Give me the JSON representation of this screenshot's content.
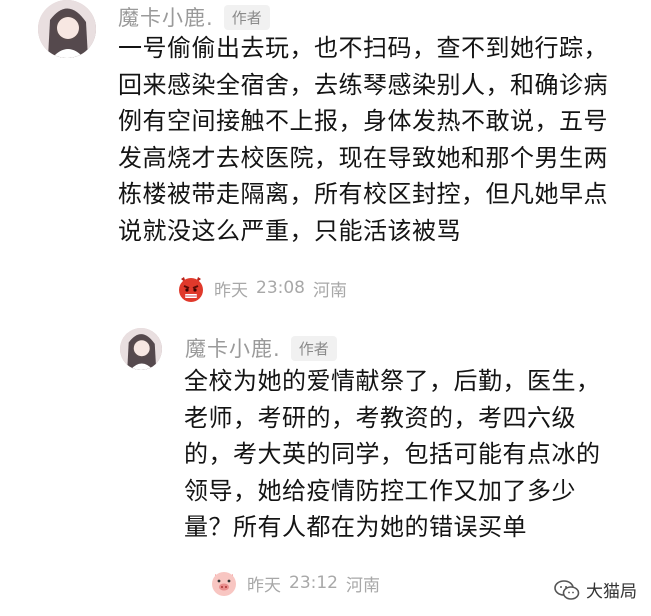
{
  "comment1": {
    "name": "魔卡小鹿.",
    "badge": "作者",
    "text": "一号偷偷出去玩，也不扫码，查不到她行踪，回来感染全宿舍，去练琴感染别人，和确诊病例有空间接触不上报，身体发热不敢说，五号发高烧才去校医院，现在导致她和那个男生两栋楼被带走隔离，所有校区封控，但凡她早点说就没这么严重，只能活该被骂",
    "emoji": "angry-face",
    "date": "昨天",
    "time": "23:08",
    "location": "河南"
  },
  "comment2": {
    "name": "魔卡小鹿.",
    "badge": "作者",
    "text": "全校为她的爱情献祭了，后勤，医生，老师，考研的，考教资的，考四六级的，考大英的同学，包括可能有点冰的领导，她给疫情防控工作又加了多少量？所有人都在为她的错误买单",
    "emoji": "pig-face",
    "date": "昨天",
    "time": "23:12",
    "location": "河南"
  },
  "watermark": {
    "icon": "wechat-icon",
    "text": "大猫局"
  }
}
